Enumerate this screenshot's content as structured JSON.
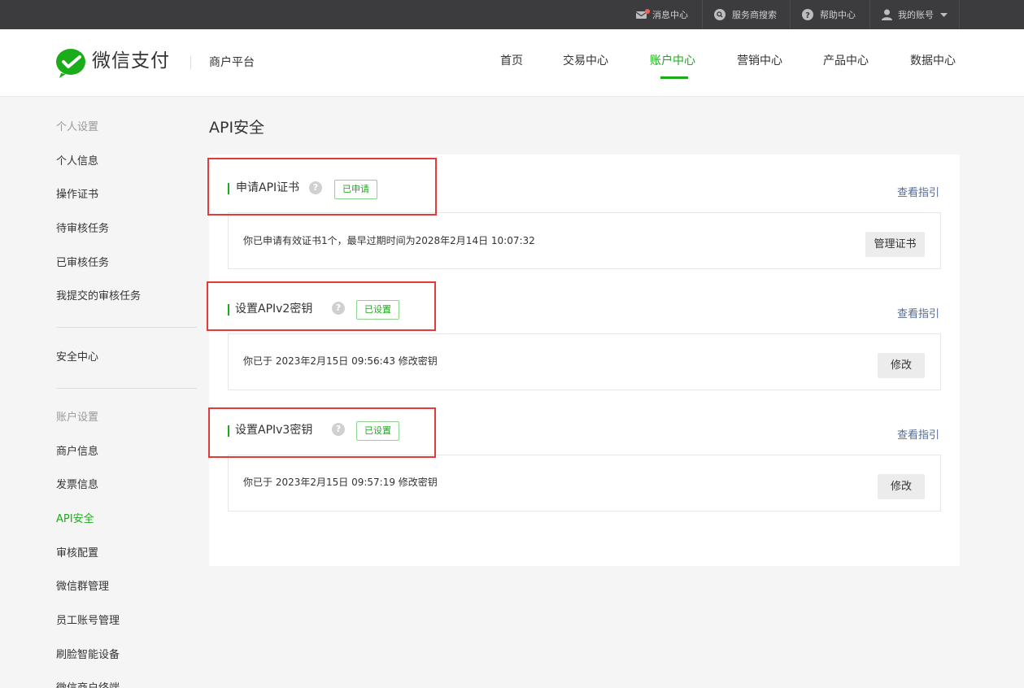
{
  "topbar": {
    "messages": "消息中心",
    "provider_search": "服务商搜索",
    "help": "帮助中心",
    "account": "我的账号"
  },
  "header": {
    "brand": "微信支付",
    "platform": "商户平台",
    "nav": [
      "首页",
      "交易中心",
      "账户中心",
      "营销中心",
      "产品中心",
      "数据中心"
    ],
    "active_nav": "账户中心"
  },
  "sidebar": {
    "group1_title": "个人设置",
    "group1_items": [
      "个人信息",
      "操作证书",
      "待审核任务",
      "已审核任务",
      "我提交的审核任务"
    ],
    "security_center": "安全中心",
    "group2_title": "账户设置",
    "group2_items": [
      "商户信息",
      "发票信息",
      "API安全",
      "审核配置",
      "微信群管理",
      "员工账号管理",
      "刷脸智能设备",
      "微信商户终端"
    ],
    "active_item": "API安全"
  },
  "main": {
    "title": "API安全",
    "sections": [
      {
        "title": "申请API证书",
        "badge": "已申请",
        "guide": "查看指引",
        "text": "你已申请有效证书1个，最早过期时间为2028年2月14日 10:07:32",
        "button": "管理证书"
      },
      {
        "title": "设置APIv2密钥",
        "badge": "已设置",
        "guide": "查看指引",
        "text": "你已于 2023年2月15日 09:56:43 修改密钥",
        "button": "修改"
      },
      {
        "title": "设置APIv3密钥",
        "badge": "已设置",
        "guide": "查看指引",
        "text": "你已于 2023年2月15日 09:57:19 修改密钥",
        "button": "修改"
      }
    ],
    "help_glyph": "?"
  },
  "colors": {
    "accent": "#1aad19",
    "topbar_bg": "#3c3c3e",
    "highlight_box": "#e43a3a",
    "link": "#576b95"
  }
}
